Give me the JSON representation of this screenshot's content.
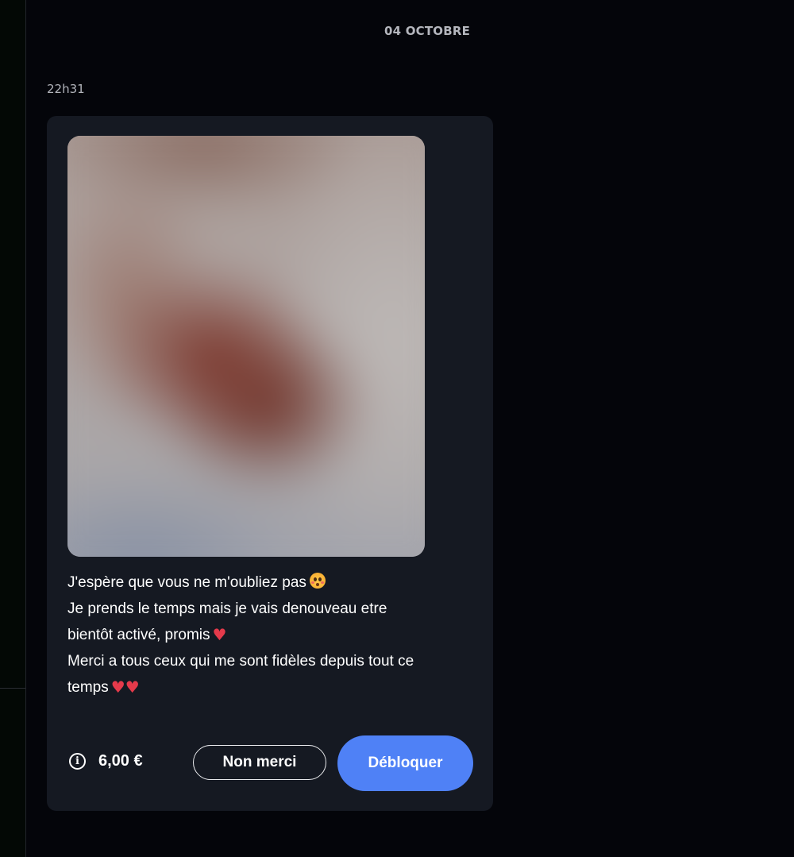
{
  "conversation": {
    "date_separator": "04 OCTOBRE",
    "message": {
      "time": "22h31",
      "media": {
        "state": "locked-blurred"
      },
      "text_lines": [
        "J'espère que vous ne m'oubliez pas",
        "Je prends le temps mais je vais denouveau etre",
        "bientôt activé, promis",
        "Merci a tous ceux qui me sont fidèles depuis tout ce",
        "temps"
      ],
      "emojis": {
        "line1": "flushed-face",
        "line3": "red-heart",
        "line5": "red-heart x2"
      },
      "unlock": {
        "info_icon": "info-icon",
        "price": "6,00 €",
        "decline_label": "Non merci",
        "unlock_label": "Débloquer"
      }
    }
  },
  "colors": {
    "background": "#04050a",
    "bubble": "#151922",
    "accent_button": "#4f81f6",
    "heart": "#e53a4b",
    "muted_text": "#b2b4bb"
  }
}
